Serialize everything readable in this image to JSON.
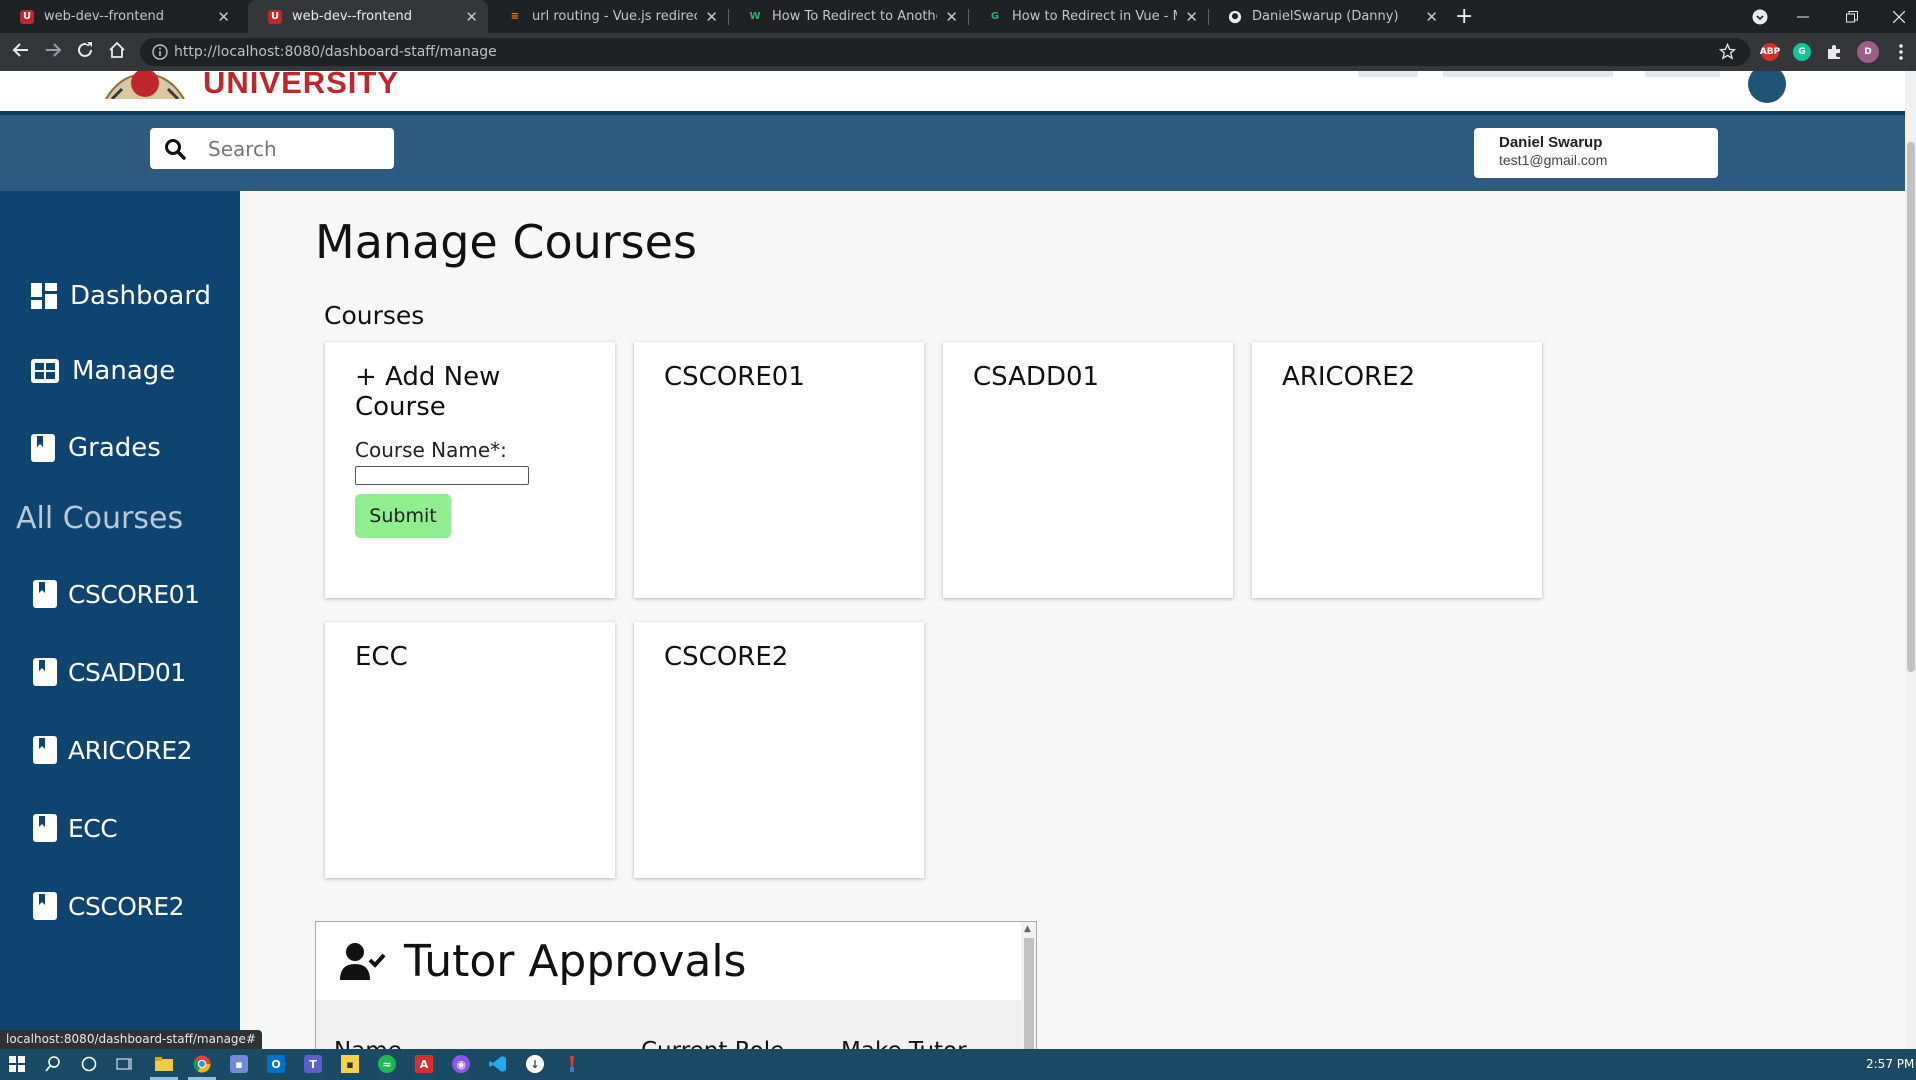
{
  "browser": {
    "tabs": [
      {
        "title": "web-dev--frontend",
        "favicon": "university-icon"
      },
      {
        "title": "web-dev--frontend",
        "favicon": "university-icon"
      },
      {
        "title": "url routing - Vue.js redirection to",
        "favicon": "stackoverflow-icon"
      },
      {
        "title": "How To Redirect to Another Web",
        "favicon": "w-icon"
      },
      {
        "title": "How to Redirect in Vue - Michael",
        "favicon": "g-icon"
      },
      {
        "title": "DanielSwarup (Danny)",
        "favicon": "github-icon"
      }
    ],
    "url": "http://localhost:8080/dashboard-staff/manage",
    "status_url": "localhost:8080/dashboard-staff/manage#"
  },
  "site": {
    "logo_text": "UNIVERSITY"
  },
  "header": {
    "search_placeholder": "Search",
    "user_name": "Daniel Swarup",
    "user_email": "test1@gmail.com"
  },
  "sidebar": {
    "items": [
      {
        "label": "Dashboard",
        "icon": "dashboard-icon"
      },
      {
        "label": "Manage",
        "icon": "table-icon"
      },
      {
        "label": "Grades",
        "icon": "bookmark-icon"
      }
    ],
    "heading": "All Courses",
    "courses": [
      "CSCORE01",
      "CSADD01",
      "ARICORE2",
      "ECC",
      "CSCORE2"
    ]
  },
  "main": {
    "title": "Manage Courses",
    "courses_label": "Courses",
    "add_card": {
      "title": "+ Add New Course",
      "field_label": "Course Name*:",
      "submit_label": "Submit"
    },
    "course_cards": [
      "CSCORE01",
      "CSADD01",
      "ARICORE2",
      "ECC",
      "CSCORE2"
    ],
    "tutor_approvals": {
      "title": "Tutor Approvals",
      "columns": [
        "Name",
        "Current Role",
        "Make Tutor"
      ]
    }
  },
  "taskbar": {
    "clock": "2:57 PM"
  },
  "colors": {
    "sidebar": "#0f4470",
    "header": "#2d5a7e",
    "submit": "#90ee90",
    "logo": "#c0262d"
  }
}
